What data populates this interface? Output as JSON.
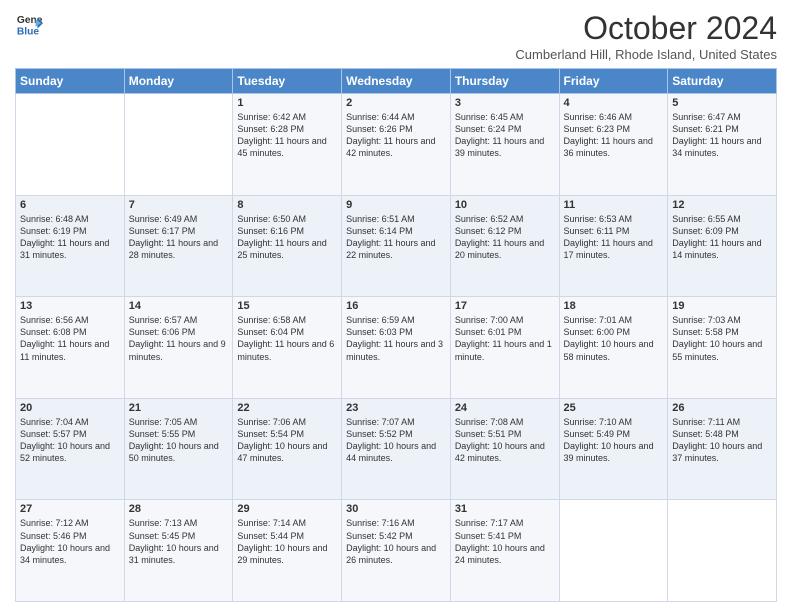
{
  "header": {
    "logo_line1": "General",
    "logo_line2": "Blue",
    "month_title": "October 2024",
    "location": "Cumberland Hill, Rhode Island, United States"
  },
  "weekdays": [
    "Sunday",
    "Monday",
    "Tuesday",
    "Wednesday",
    "Thursday",
    "Friday",
    "Saturday"
  ],
  "weeks": [
    [
      {
        "day": "",
        "sunrise": "",
        "sunset": "",
        "daylight": ""
      },
      {
        "day": "",
        "sunrise": "",
        "sunset": "",
        "daylight": ""
      },
      {
        "day": "1",
        "sunrise": "Sunrise: 6:42 AM",
        "sunset": "Sunset: 6:28 PM",
        "daylight": "Daylight: 11 hours and 45 minutes."
      },
      {
        "day": "2",
        "sunrise": "Sunrise: 6:44 AM",
        "sunset": "Sunset: 6:26 PM",
        "daylight": "Daylight: 11 hours and 42 minutes."
      },
      {
        "day": "3",
        "sunrise": "Sunrise: 6:45 AM",
        "sunset": "Sunset: 6:24 PM",
        "daylight": "Daylight: 11 hours and 39 minutes."
      },
      {
        "day": "4",
        "sunrise": "Sunrise: 6:46 AM",
        "sunset": "Sunset: 6:23 PM",
        "daylight": "Daylight: 11 hours and 36 minutes."
      },
      {
        "day": "5",
        "sunrise": "Sunrise: 6:47 AM",
        "sunset": "Sunset: 6:21 PM",
        "daylight": "Daylight: 11 hours and 34 minutes."
      }
    ],
    [
      {
        "day": "6",
        "sunrise": "Sunrise: 6:48 AM",
        "sunset": "Sunset: 6:19 PM",
        "daylight": "Daylight: 11 hours and 31 minutes."
      },
      {
        "day": "7",
        "sunrise": "Sunrise: 6:49 AM",
        "sunset": "Sunset: 6:17 PM",
        "daylight": "Daylight: 11 hours and 28 minutes."
      },
      {
        "day": "8",
        "sunrise": "Sunrise: 6:50 AM",
        "sunset": "Sunset: 6:16 PM",
        "daylight": "Daylight: 11 hours and 25 minutes."
      },
      {
        "day": "9",
        "sunrise": "Sunrise: 6:51 AM",
        "sunset": "Sunset: 6:14 PM",
        "daylight": "Daylight: 11 hours and 22 minutes."
      },
      {
        "day": "10",
        "sunrise": "Sunrise: 6:52 AM",
        "sunset": "Sunset: 6:12 PM",
        "daylight": "Daylight: 11 hours and 20 minutes."
      },
      {
        "day": "11",
        "sunrise": "Sunrise: 6:53 AM",
        "sunset": "Sunset: 6:11 PM",
        "daylight": "Daylight: 11 hours and 17 minutes."
      },
      {
        "day": "12",
        "sunrise": "Sunrise: 6:55 AM",
        "sunset": "Sunset: 6:09 PM",
        "daylight": "Daylight: 11 hours and 14 minutes."
      }
    ],
    [
      {
        "day": "13",
        "sunrise": "Sunrise: 6:56 AM",
        "sunset": "Sunset: 6:08 PM",
        "daylight": "Daylight: 11 hours and 11 minutes."
      },
      {
        "day": "14",
        "sunrise": "Sunrise: 6:57 AM",
        "sunset": "Sunset: 6:06 PM",
        "daylight": "Daylight: 11 hours and 9 minutes."
      },
      {
        "day": "15",
        "sunrise": "Sunrise: 6:58 AM",
        "sunset": "Sunset: 6:04 PM",
        "daylight": "Daylight: 11 hours and 6 minutes."
      },
      {
        "day": "16",
        "sunrise": "Sunrise: 6:59 AM",
        "sunset": "Sunset: 6:03 PM",
        "daylight": "Daylight: 11 hours and 3 minutes."
      },
      {
        "day": "17",
        "sunrise": "Sunrise: 7:00 AM",
        "sunset": "Sunset: 6:01 PM",
        "daylight": "Daylight: 11 hours and 1 minute."
      },
      {
        "day": "18",
        "sunrise": "Sunrise: 7:01 AM",
        "sunset": "Sunset: 6:00 PM",
        "daylight": "Daylight: 10 hours and 58 minutes."
      },
      {
        "day": "19",
        "sunrise": "Sunrise: 7:03 AM",
        "sunset": "Sunset: 5:58 PM",
        "daylight": "Daylight: 10 hours and 55 minutes."
      }
    ],
    [
      {
        "day": "20",
        "sunrise": "Sunrise: 7:04 AM",
        "sunset": "Sunset: 5:57 PM",
        "daylight": "Daylight: 10 hours and 52 minutes."
      },
      {
        "day": "21",
        "sunrise": "Sunrise: 7:05 AM",
        "sunset": "Sunset: 5:55 PM",
        "daylight": "Daylight: 10 hours and 50 minutes."
      },
      {
        "day": "22",
        "sunrise": "Sunrise: 7:06 AM",
        "sunset": "Sunset: 5:54 PM",
        "daylight": "Daylight: 10 hours and 47 minutes."
      },
      {
        "day": "23",
        "sunrise": "Sunrise: 7:07 AM",
        "sunset": "Sunset: 5:52 PM",
        "daylight": "Daylight: 10 hours and 44 minutes."
      },
      {
        "day": "24",
        "sunrise": "Sunrise: 7:08 AM",
        "sunset": "Sunset: 5:51 PM",
        "daylight": "Daylight: 10 hours and 42 minutes."
      },
      {
        "day": "25",
        "sunrise": "Sunrise: 7:10 AM",
        "sunset": "Sunset: 5:49 PM",
        "daylight": "Daylight: 10 hours and 39 minutes."
      },
      {
        "day": "26",
        "sunrise": "Sunrise: 7:11 AM",
        "sunset": "Sunset: 5:48 PM",
        "daylight": "Daylight: 10 hours and 37 minutes."
      }
    ],
    [
      {
        "day": "27",
        "sunrise": "Sunrise: 7:12 AM",
        "sunset": "Sunset: 5:46 PM",
        "daylight": "Daylight: 10 hours and 34 minutes."
      },
      {
        "day": "28",
        "sunrise": "Sunrise: 7:13 AM",
        "sunset": "Sunset: 5:45 PM",
        "daylight": "Daylight: 10 hours and 31 minutes."
      },
      {
        "day": "29",
        "sunrise": "Sunrise: 7:14 AM",
        "sunset": "Sunset: 5:44 PM",
        "daylight": "Daylight: 10 hours and 29 minutes."
      },
      {
        "day": "30",
        "sunrise": "Sunrise: 7:16 AM",
        "sunset": "Sunset: 5:42 PM",
        "daylight": "Daylight: 10 hours and 26 minutes."
      },
      {
        "day": "31",
        "sunrise": "Sunrise: 7:17 AM",
        "sunset": "Sunset: 5:41 PM",
        "daylight": "Daylight: 10 hours and 24 minutes."
      },
      {
        "day": "",
        "sunrise": "",
        "sunset": "",
        "daylight": ""
      },
      {
        "day": "",
        "sunrise": "",
        "sunset": "",
        "daylight": ""
      }
    ]
  ]
}
